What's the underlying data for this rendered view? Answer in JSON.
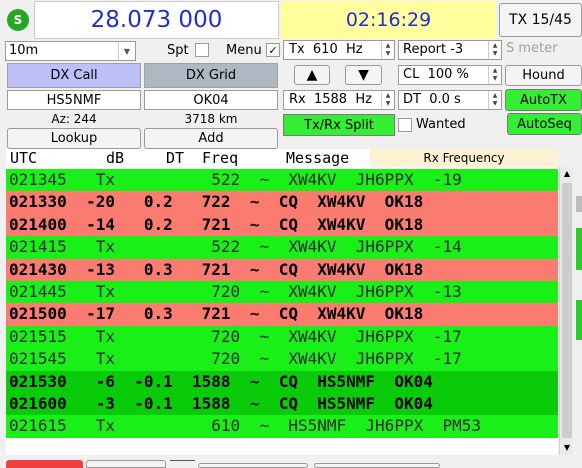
{
  "header": {
    "status_glyph": "S",
    "frequency": "28.073 000",
    "utc_time": "02:16:29",
    "tx_period": "TX 15/45"
  },
  "left_panel": {
    "band": "10m",
    "spt_label": "Spt",
    "menu_label": "Menu",
    "menu_checked": true,
    "dx_call_label": "DX Call",
    "dx_grid_label": "DX Grid",
    "dx_call_value": "HS5NMF",
    "dx_grid_value": "OK04",
    "azimuth": "Az: 244",
    "distance": "3718 km",
    "lookup_label": "Lookup",
    "add_label": "Add"
  },
  "mid_panel": {
    "tx_freq": "Tx  610  Hz",
    "rx_freq": "Rx  1588  Hz",
    "up_arrow": "▲",
    "down_arrow": "▼",
    "txrx_split_label": "Tx/Rx Split"
  },
  "right_panel": {
    "report": "Report -3",
    "s_meter_placeholder": "S meter",
    "cl": "CL  100 %",
    "dt": "DT  0.0 s",
    "hound_label": "Hound",
    "autotx_label": "AutoTX",
    "autoseq_label": "AutoSeq",
    "wanted_label": "Wanted"
  },
  "decode": {
    "headers": {
      "utc": "UTC",
      "db": "dB",
      "dt": "DT",
      "freq": "Freq",
      "message": "Message"
    },
    "rx_freq_label": "Rx Frequency",
    "rows": [
      {
        "text": "021345   Tx          522  ~  XW4KV  JH6PPX  -19",
        "kind": "tx"
      },
      {
        "text": "021330  -20   0.2   722  ~  CQ  XW4KV  OK18",
        "kind": "cq"
      },
      {
        "text": "021400  -14   0.2   721  ~  CQ  XW4KV  OK18",
        "kind": "cq"
      },
      {
        "text": "021415   Tx          522  ~  XW4KV  JH6PPX  -14",
        "kind": "tx"
      },
      {
        "text": "021430  -13   0.3   721  ~  CQ  XW4KV  OK18",
        "kind": "cq"
      },
      {
        "text": "021445   Tx          720  ~  XW4KV  JH6PPX  -13",
        "kind": "tx"
      },
      {
        "text": "021500  -17   0.3   721  ~  CQ  XW4KV  OK18",
        "kind": "cq"
      },
      {
        "text": "021515   Tx          720  ~  XW4KV  JH6PPX  -17",
        "kind": "tx"
      },
      {
        "text": "021545   Tx          720  ~  XW4KV  JH6PPX  -17",
        "kind": "tx"
      },
      {
        "text": "021530   -6  -0.1  1588  ~  CQ  HS5NMF  OK04",
        "kind": "rx"
      },
      {
        "text": "021600   -3  -0.1  1588  ~  CQ  HS5NMF  OK04",
        "kind": "rx"
      },
      {
        "text": "021615   Tx          610  ~  HS5NMF  JH6PPX  PM53",
        "kind": "tx"
      }
    ]
  },
  "colors": {
    "tx_row": "#18f018",
    "cq_row": "#fa7b70",
    "rx_row": "#0acb0a",
    "frequency_text": "#1f2fd0",
    "time_bg": "#ffff9e",
    "dx_call_bg": "#bebff8",
    "dx_grid_bg": "#adb8c2",
    "green_button": "#33ee33"
  }
}
